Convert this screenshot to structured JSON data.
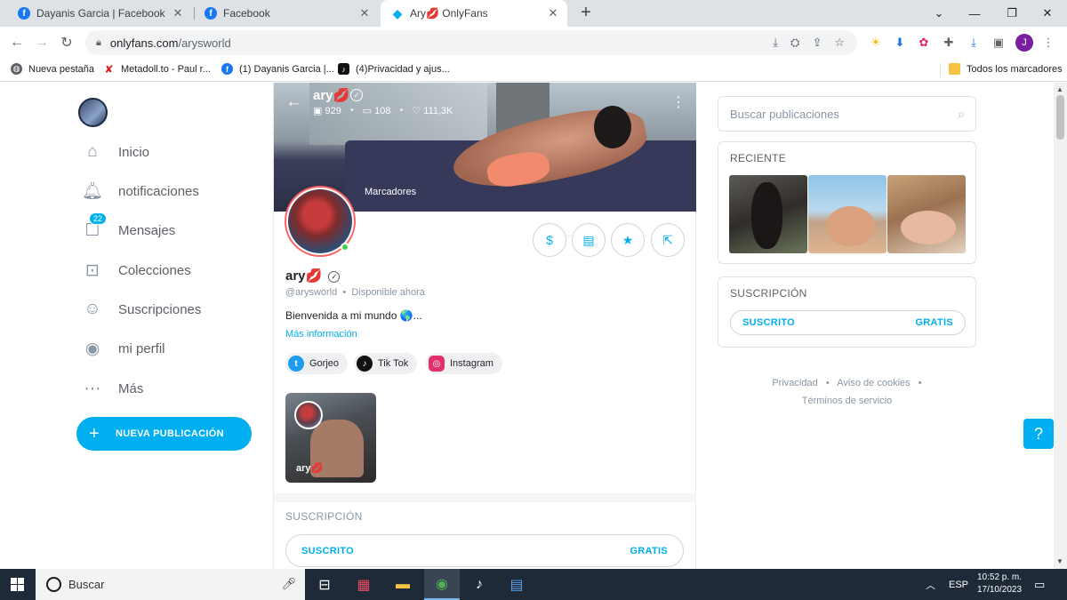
{
  "browser": {
    "tabs": [
      {
        "title": "Dayanis Garcia | Facebook",
        "icon": "facebook-icon"
      },
      {
        "title": "Facebook",
        "icon": "facebook-icon"
      },
      {
        "title": "Ary💋 OnlyFans",
        "icon": "onlyfans-icon"
      }
    ],
    "url_host": "onlyfans.com",
    "url_path": "/arysworld",
    "profile_initial": "J",
    "bookmarks": [
      {
        "label": "Nueva pestaña",
        "icon": "globe-icon"
      },
      {
        "label": "Metadoll.to - Paul r...",
        "icon": "metadoll-icon"
      },
      {
        "label": "(1) Dayanis Garcia |...",
        "icon": "facebook-icon"
      },
      {
        "label": "(4)Privacidad y ajus...",
        "icon": "tiktok-icon"
      }
    ],
    "all_bookmarks": "Todos los marcadores"
  },
  "sidebar": {
    "items": [
      {
        "label": "Inicio",
        "icon": "home-icon"
      },
      {
        "label": "notificaciones",
        "icon": "bell-icon"
      },
      {
        "label": "Mensajes",
        "icon": "message-icon",
        "badge": "22"
      },
      {
        "label": "Colecciones",
        "icon": "collections-icon"
      },
      {
        "label": "Suscripciones",
        "icon": "subscriptions-icon"
      },
      {
        "label": "mi perfil",
        "icon": "profile-icon"
      },
      {
        "label": "Más",
        "icon": "more-icon"
      }
    ],
    "new_post": "NUEVA PUBLICACIÓN"
  },
  "profile": {
    "cover_name": "ary💋",
    "stats": {
      "photos": "929",
      "videos": "108",
      "likes": "111,3K"
    },
    "bookmarks_label": "Marcadores",
    "name": "ary💋",
    "handle": "@arysworld",
    "status": "Disponible ahora",
    "bio": "Bienvenida a mi mundo 🌎...",
    "more_info": "Más información",
    "social": [
      {
        "label": "Gorjeo",
        "icon": "twitter-icon",
        "color": "#1d9bf0"
      },
      {
        "label": "Tik Tok",
        "icon": "tiktok-icon",
        "color": "#111111"
      },
      {
        "label": "Instagram",
        "icon": "instagram-icon",
        "color": "#e1306c"
      }
    ],
    "post_name": "ary💋",
    "subscription_title": "SUSCRIPCIÓN",
    "subscribed": "SUSCRITO",
    "free": "GRATIS",
    "tip_symbol": "$"
  },
  "right": {
    "search_placeholder": "Buscar publicaciones",
    "recent_title": "RECIENTE",
    "subscription_title": "SUSCRIPCIÓN",
    "subscribed": "SUSCRITO",
    "free": "GRATIS",
    "footer": {
      "privacy": "Privacidad",
      "cookies": "Aviso de cookies",
      "terms": "Términos de servicio"
    }
  },
  "taskbar": {
    "search": "Buscar",
    "lang": "ESP",
    "time": "10:52 p. m.",
    "date": "17/10/2023"
  },
  "colors": {
    "accent": "#00aff0",
    "taskbar": "#1f2a38",
    "tabstrip": "#dee1e6"
  }
}
